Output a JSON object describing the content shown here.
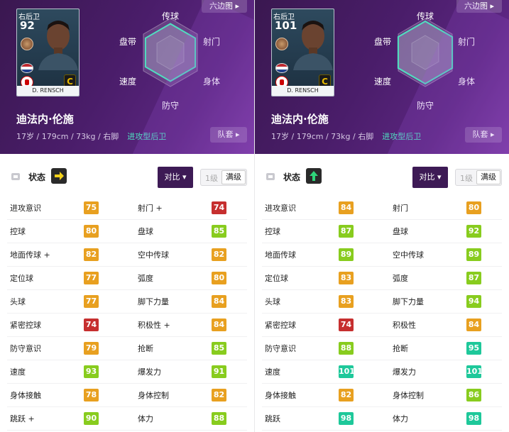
{
  "colors": {
    "red": "#c62f2f",
    "orange": "#e8a020",
    "lime": "#88cc1e",
    "green": "#3fcc5a",
    "teal": "#1ec89a",
    "radar_line": "#4fe0c0",
    "header_purple": "#4a1d6a"
  },
  "panels": [
    {
      "id": "left",
      "header": {
        "hex_button": "六边图",
        "squad_button": "队套",
        "card": {
          "position": "右后卫",
          "rating": "92",
          "name": "D. RENSCH",
          "tier": "C"
        },
        "radar_labels": {
          "top": "传球",
          "left_upper": "盘带",
          "right_upper": "射门",
          "left_lower": "速度",
          "right_lower": "身体",
          "bottom": "防守"
        },
        "player_name": "迪法内·伦施",
        "meta": "17岁 / 179cm / 73kg / 右脚",
        "role": "进攻型后卫"
      },
      "status": {
        "label": "状态",
        "arrow": "right-arrow",
        "compare_button": "对比",
        "level_1": "1级",
        "level_max": "满级"
      },
      "stats": [
        {
          "l_name": "进攻意识",
          "l_val": "75",
          "l_color": "orange",
          "r_name": "射门 +",
          "r_val": "74",
          "r_color": "red"
        },
        {
          "l_name": "控球",
          "l_val": "80",
          "l_color": "orange",
          "r_name": "盘球",
          "r_val": "85",
          "r_color": "lime"
        },
        {
          "l_name": "地面传球 +",
          "l_val": "82",
          "l_color": "orange",
          "r_name": "空中传球",
          "r_val": "82",
          "r_color": "orange"
        },
        {
          "l_name": "定位球",
          "l_val": "77",
          "l_color": "orange",
          "r_name": "弧度",
          "r_val": "80",
          "r_color": "orange"
        },
        {
          "l_name": "头球",
          "l_val": "77",
          "l_color": "orange",
          "r_name": "脚下力量",
          "r_val": "84",
          "r_color": "orange"
        },
        {
          "l_name": "紧密控球",
          "l_val": "74",
          "l_color": "red",
          "r_name": "积极性 +",
          "r_val": "84",
          "r_color": "orange"
        },
        {
          "l_name": "防守意识",
          "l_val": "79",
          "l_color": "orange",
          "r_name": "抢断",
          "r_val": "85",
          "r_color": "lime"
        },
        {
          "l_name": "速度",
          "l_val": "93",
          "l_color": "lime",
          "r_name": "爆发力",
          "r_val": "91",
          "r_color": "lime"
        },
        {
          "l_name": "身体接触",
          "l_val": "78",
          "l_color": "orange",
          "r_name": "身体控制",
          "r_val": "82",
          "r_color": "orange"
        },
        {
          "l_name": "跳跃 +",
          "l_val": "90",
          "l_color": "lime",
          "r_name": "体力",
          "r_val": "88",
          "r_color": "lime"
        }
      ]
    },
    {
      "id": "right",
      "header": {
        "hex_button": "六边图",
        "squad_button": "队套",
        "card": {
          "position": "右后卫",
          "rating": "101",
          "name": "D. RENSCH",
          "tier": "C"
        },
        "radar_labels": {
          "top": "传球",
          "left_upper": "盘带",
          "right_upper": "射门",
          "left_lower": "速度",
          "right_lower": "身体",
          "bottom": "防守"
        },
        "player_name": "迪法内·伦施",
        "meta": "17岁 / 179cm / 73kg / 右脚",
        "role": "进攻型后卫"
      },
      "status": {
        "label": "状态",
        "arrow": "up-arrow",
        "compare_button": "对比",
        "level_1": "1级",
        "level_max": "满级"
      },
      "stats": [
        {
          "l_name": "进攻意识",
          "l_val": "84",
          "l_color": "orange",
          "r_name": "射门",
          "r_val": "80",
          "r_color": "orange"
        },
        {
          "l_name": "控球",
          "l_val": "87",
          "l_color": "lime",
          "r_name": "盘球",
          "r_val": "92",
          "r_color": "lime"
        },
        {
          "l_name": "地面传球",
          "l_val": "89",
          "l_color": "lime",
          "r_name": "空中传球",
          "r_val": "89",
          "r_color": "lime"
        },
        {
          "l_name": "定位球",
          "l_val": "83",
          "l_color": "orange",
          "r_name": "弧度",
          "r_val": "87",
          "r_color": "lime"
        },
        {
          "l_name": "头球",
          "l_val": "83",
          "l_color": "orange",
          "r_name": "脚下力量",
          "r_val": "94",
          "r_color": "lime"
        },
        {
          "l_name": "紧密控球",
          "l_val": "74",
          "l_color": "red",
          "r_name": "积极性",
          "r_val": "84",
          "r_color": "orange"
        },
        {
          "l_name": "防守意识",
          "l_val": "88",
          "l_color": "lime",
          "r_name": "抢断",
          "r_val": "95",
          "r_color": "teal"
        },
        {
          "l_name": "速度",
          "l_val": "101",
          "l_color": "teal",
          "r_name": "爆发力",
          "r_val": "101",
          "r_color": "teal"
        },
        {
          "l_name": "身体接触",
          "l_val": "82",
          "l_color": "orange",
          "r_name": "身体控制",
          "r_val": "86",
          "r_color": "lime"
        },
        {
          "l_name": "跳跃",
          "l_val": "98",
          "l_color": "teal",
          "r_name": "体力",
          "r_val": "98",
          "r_color": "teal"
        }
      ]
    }
  ]
}
